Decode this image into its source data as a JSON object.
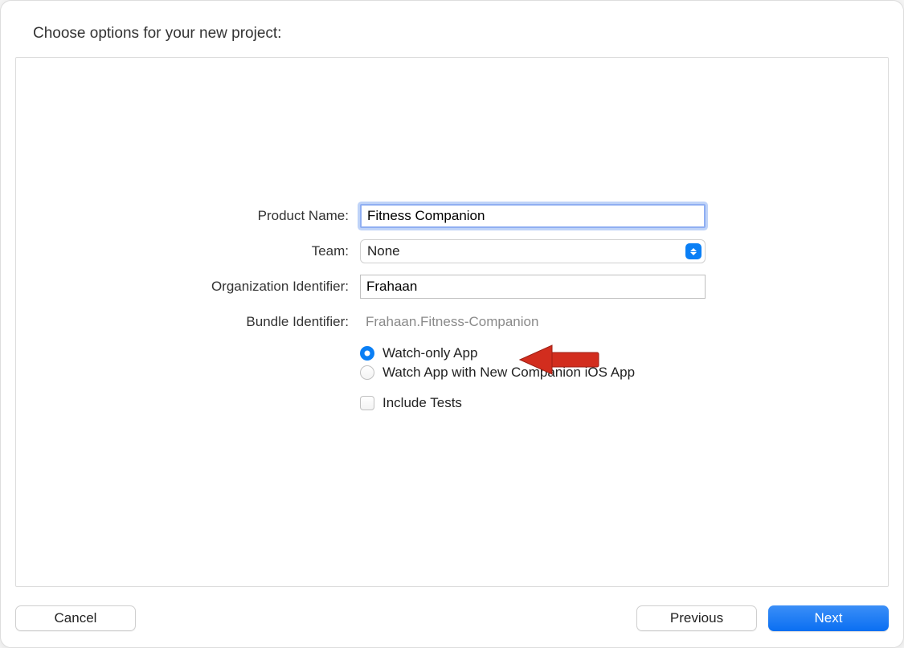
{
  "header": {
    "title": "Choose options for your new project:"
  },
  "form": {
    "product_name": {
      "label": "Product Name:",
      "value": "Fitness Companion"
    },
    "team": {
      "label": "Team:",
      "selected": "None"
    },
    "org_identifier": {
      "label": "Organization Identifier:",
      "value": "Frahaan"
    },
    "bundle_identifier": {
      "label": "Bundle Identifier:",
      "value": "Frahaan.Fitness-Companion"
    },
    "radios": {
      "watch_only": {
        "label": "Watch-only App",
        "checked": true
      },
      "watch_with_companion": {
        "label": "Watch App with New Companion iOS App",
        "checked": false
      }
    },
    "include_tests": {
      "label": "Include Tests",
      "checked": false
    }
  },
  "footer": {
    "cancel": "Cancel",
    "previous": "Previous",
    "next": "Next"
  },
  "annotation": {
    "arrow_color": "#d22d1e"
  }
}
